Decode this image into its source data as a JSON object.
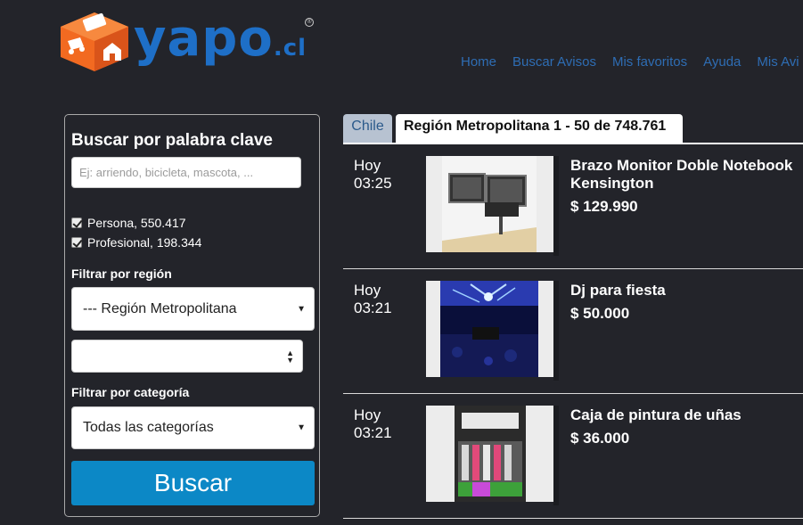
{
  "header": {
    "logo_text": "yapo",
    "logo_suffix": ".cl",
    "logo_reg": "®",
    "nav": [
      "Home",
      "Buscar Avisos",
      "Mis favoritos",
      "Ayuda",
      "Mis Avi"
    ]
  },
  "sidebar": {
    "title": "Buscar por palabra clave",
    "search_placeholder": "Ej: arriendo, bicicleta, mascota, ...",
    "checkbox_persona": "Persona, 550.417",
    "checkbox_profesional": "Profesional, 198.344",
    "region_label": "Filtrar por región",
    "region_value": "--- Región Metropolitana",
    "commune_value": "",
    "category_label": "Filtrar por categoría",
    "category_value": "Todas las categorías",
    "search_button": "Buscar"
  },
  "tabs": {
    "chile": "Chile",
    "region": "Región Metropolitana 1 - 50 de 748.761"
  },
  "listings": [
    {
      "day": "Hoy",
      "time": "03:25",
      "title": "Brazo Monitor Doble Notebook Kensington",
      "price": "$ 129.990"
    },
    {
      "day": "Hoy",
      "time": "03:21",
      "title": "Dj para fiesta",
      "price": "$ 50.000"
    },
    {
      "day": "Hoy",
      "time": "03:21",
      "title": "Caja de pintura de uñas",
      "price": "$ 36.000"
    }
  ],
  "colors": {
    "background": "#23242a",
    "brand_blue": "#1e6fc7",
    "brand_orange": "#f26a21",
    "button_blue": "#0c88c6",
    "nav_link": "#2e6db4"
  }
}
